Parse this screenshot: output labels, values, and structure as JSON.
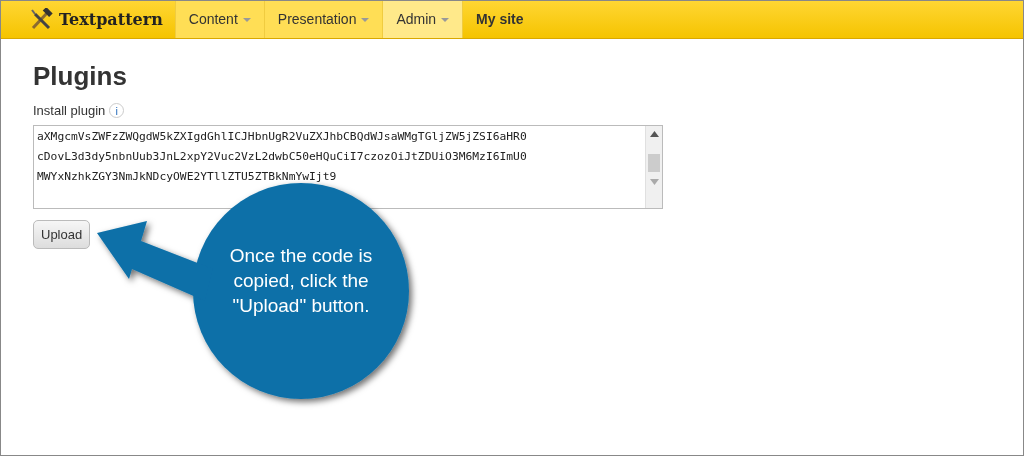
{
  "brand": "Textpattern",
  "nav": [
    {
      "label": "Content",
      "dropdown": true,
      "selected": false
    },
    {
      "label": "Presentation",
      "dropdown": true,
      "selected": false
    },
    {
      "label": "Admin",
      "dropdown": true,
      "selected": true
    },
    {
      "label": "My site",
      "dropdown": false,
      "selected": false
    }
  ],
  "page_title": "Plugins",
  "install_label": "Install plugin",
  "info_icon": "i",
  "code_lines": [
    "aXMgcmVsZWFzZWQgdW5kZXIgdGhlICJHbnUgR2VuZXJhbCBQdWJsaWMgTGljZW5jZSI6aHR0",
    "cDovL3d3dy5nbnUub3JnL2xpY2Vuc2VzL2dwbC50eHQuCiI7czozOiJtZDUiO3M6MzI6ImU0",
    "MWYxNzhkZGY3NmJkNDcyOWE2YTllZTU5ZTBkNmYwIjt9"
  ],
  "upload_button": "Upload",
  "callout": "Once the code is copied, click the \"Upload\" button."
}
